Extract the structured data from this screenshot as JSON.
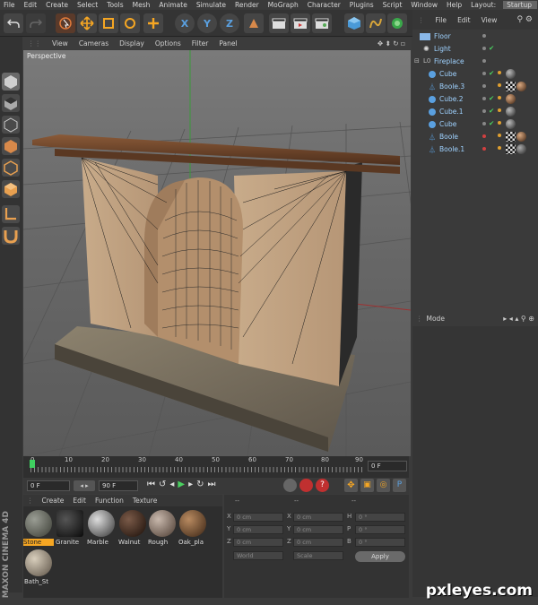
{
  "menu": {
    "items": [
      "File",
      "Edit",
      "Create",
      "Select",
      "Tools",
      "Mesh",
      "Animate",
      "Simulate",
      "Render",
      "MoGraph",
      "Character",
      "Plugins",
      "Script",
      "Window",
      "Help"
    ],
    "layout_label": "Layout:",
    "layout_value": "Startup"
  },
  "toolbar": {
    "axis_x": "X",
    "axis_y": "Y",
    "axis_z": "Z"
  },
  "viewport": {
    "menu": [
      "View",
      "Cameras",
      "Display",
      "Options",
      "Filter",
      "Panel"
    ],
    "label": "Perspective"
  },
  "timeline": {
    "ticks": [
      "0",
      "10",
      "20",
      "30",
      "40",
      "50",
      "60",
      "70",
      "80",
      "90"
    ],
    "current_frame": "0 F",
    "start_frame": "0 F",
    "end_frame": "90 F"
  },
  "object_manager": {
    "menu": [
      "File",
      "Edit",
      "View"
    ],
    "objects": [
      {
        "name": "Floor"
      },
      {
        "name": "Light"
      },
      {
        "name": "Fireplace"
      },
      {
        "name": "Cube"
      },
      {
        "name": "Boole.3"
      },
      {
        "name": "Cube.2"
      },
      {
        "name": "Cube.1"
      },
      {
        "name": "Cube"
      },
      {
        "name": "Boole"
      },
      {
        "name": "Boole.1"
      }
    ]
  },
  "attributes": {
    "mode_label": "Mode"
  },
  "material_manager": {
    "menu": [
      "Create",
      "Edit",
      "Function",
      "Texture"
    ],
    "materials": [
      {
        "label": "Stone",
        "color": "#6a6d64"
      },
      {
        "label": "Granite",
        "color": "#1c1c1c"
      },
      {
        "label": "Marble",
        "color": "#8a8a8a"
      },
      {
        "label": "Walnut",
        "color": "#3a2418"
      },
      {
        "label": "Rough",
        "color": "#8c7a6e"
      },
      {
        "label": "Oak_pla",
        "color": "#7a5a3c"
      },
      {
        "label": "Bath_St",
        "color": "#a39888"
      }
    ]
  },
  "coordinates": {
    "dash1": "--",
    "dash2": "--",
    "dash3": "--",
    "rows": [
      {
        "a": "X",
        "av": "0 cm",
        "b": "X",
        "bv": "0 cm",
        "c": "H",
        "cv": "0 °"
      },
      {
        "a": "Y",
        "av": "0 cm",
        "b": "Y",
        "bv": "0 cm",
        "c": "P",
        "cv": "0 °"
      },
      {
        "a": "Z",
        "av": "0 cm",
        "b": "Z",
        "bv": "0 cm",
        "c": "B",
        "cv": "0 °"
      }
    ],
    "world": "World",
    "scale": "Scale",
    "apply": "Apply"
  },
  "brand": {
    "vertical": "MAXON CINEMA 4D",
    "watermark": "pxleyes.com"
  },
  "colors": {
    "accent_orange": "#f5a623",
    "selection_blue": "#9fd2ff"
  }
}
